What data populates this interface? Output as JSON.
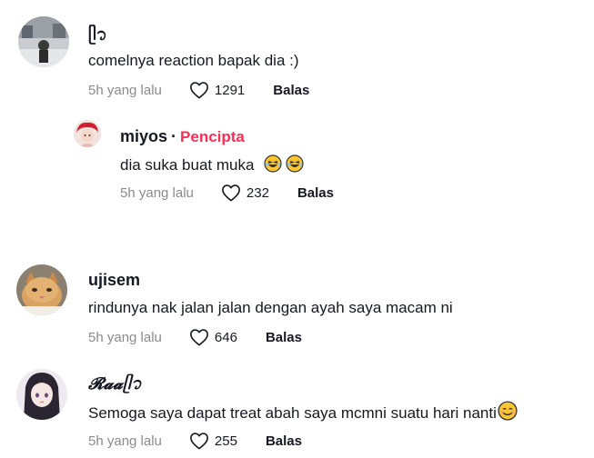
{
  "comments": [
    {
      "username": "ᥫ᭡",
      "text": "comelnya reaction bapak dia :)",
      "time": "5h yang lalu",
      "likes": "1291",
      "reply_label": "Balas"
    },
    {
      "username": "miyos",
      "separator": "·",
      "badge": "Pencipta",
      "text": "dia suka buat muka",
      "time": "5h yang lalu",
      "likes": "232",
      "reply_label": "Balas",
      "emojis": [
        "laughing-face-emoji",
        "laughing-face-emoji"
      ]
    },
    {
      "username": "ujisem",
      "text": "rindunya nak jalan jalan dengan ayah saya macam ni",
      "time": "5h yang lalu",
      "likes": "646",
      "reply_label": "Balas"
    },
    {
      "username": "𝓡𝓪𝓪ᥫ᭡",
      "text": "Semoga saya dapat treat abah saya mcmni suatu hari nanti",
      "time": "5h yang lalu",
      "likes": "255",
      "reply_label": "Balas",
      "emojis": [
        "smiling-face-emoji"
      ]
    }
  ],
  "colors": {
    "text": "#161823",
    "muted": "#8a8b91",
    "creator_badge": "#fe2c55"
  },
  "icons": {
    "like": "heart-outline-icon"
  }
}
